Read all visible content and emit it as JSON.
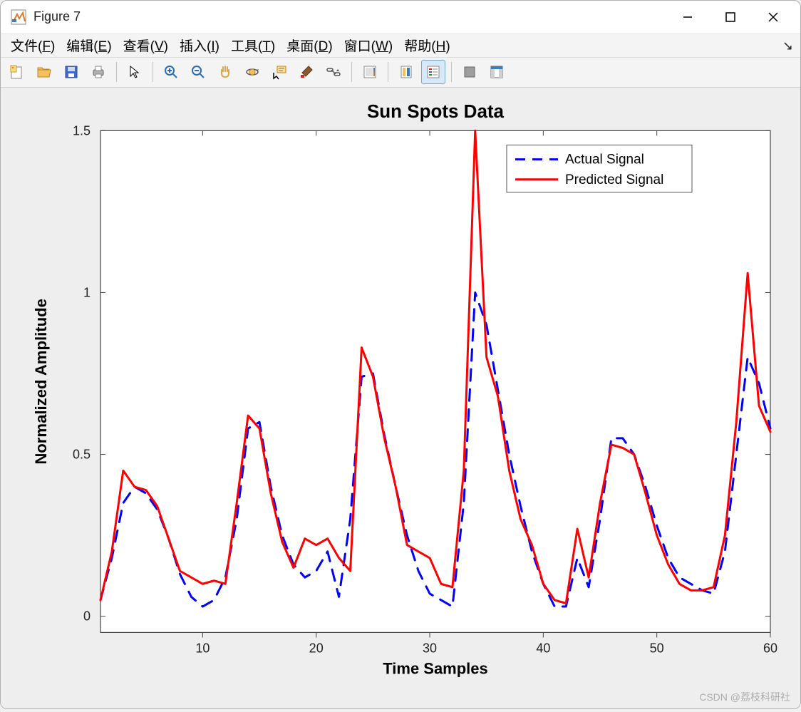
{
  "window": {
    "title": "Figure 7"
  },
  "menu": {
    "items": [
      {
        "label": "文件",
        "hotkey": "F"
      },
      {
        "label": "编辑",
        "hotkey": "E"
      },
      {
        "label": "查看",
        "hotkey": "V"
      },
      {
        "label": "插入",
        "hotkey": "I"
      },
      {
        "label": "工具",
        "hotkey": "T"
      },
      {
        "label": "桌面",
        "hotkey": "D"
      },
      {
        "label": "窗口",
        "hotkey": "W"
      },
      {
        "label": "帮助",
        "hotkey": "H"
      }
    ]
  },
  "toolbar": {
    "icons": [
      "new-figure",
      "open",
      "save",
      "print",
      "|",
      "pointer",
      "|",
      "zoom-in",
      "zoom-out",
      "pan",
      "rotate3d",
      "data-cursor",
      "brush",
      "link",
      "|",
      "colorbar",
      "|",
      "legend",
      "insert-legend",
      "|",
      "hide",
      "dock"
    ]
  },
  "watermark": "CSDN @荔枝科研社",
  "chart_data": {
    "type": "line",
    "title": "Sun Spots Data",
    "xlabel": "Time Samples",
    "ylabel": "Normalized Amplitude",
    "x_ticks": [
      10,
      20,
      30,
      40,
      50,
      60
    ],
    "y_ticks": [
      0,
      0.5,
      1,
      1.5
    ],
    "xlim": [
      1,
      60
    ],
    "ylim": [
      -0.05,
      1.5
    ],
    "legend": {
      "position": "upper-right",
      "entries": [
        "Actual Signal",
        "Predicted Signal"
      ]
    },
    "series": [
      {
        "name": "Actual Signal",
        "color": "#0000ff",
        "style": "dashed",
        "width": 3,
        "x": [
          1,
          2,
          3,
          4,
          5,
          6,
          7,
          8,
          9,
          10,
          11,
          12,
          13,
          14,
          15,
          16,
          17,
          18,
          19,
          20,
          21,
          22,
          23,
          24,
          25,
          26,
          27,
          28,
          29,
          30,
          31,
          32,
          33,
          34,
          35,
          36,
          37,
          38,
          39,
          40,
          41,
          42,
          43,
          44,
          45,
          46,
          47,
          48,
          49,
          50,
          51,
          52,
          53,
          54,
          55,
          56,
          57,
          58,
          59,
          60
        ],
        "y": [
          0.05,
          0.18,
          0.35,
          0.4,
          0.38,
          0.33,
          0.24,
          0.13,
          0.06,
          0.03,
          0.05,
          0.12,
          0.3,
          0.58,
          0.6,
          0.4,
          0.25,
          0.16,
          0.12,
          0.14,
          0.2,
          0.06,
          0.3,
          0.74,
          0.75,
          0.56,
          0.4,
          0.25,
          0.14,
          0.07,
          0.05,
          0.03,
          0.35,
          1.0,
          0.9,
          0.7,
          0.5,
          0.34,
          0.2,
          0.1,
          0.03,
          0.03,
          0.18,
          0.09,
          0.3,
          0.55,
          0.55,
          0.5,
          0.4,
          0.28,
          0.18,
          0.12,
          0.1,
          0.08,
          0.07,
          0.2,
          0.5,
          0.8,
          0.72,
          0.58
        ]
      },
      {
        "name": "Predicted Signal",
        "color": "#ff0000",
        "style": "solid",
        "width": 3,
        "x": [
          1,
          2,
          3,
          4,
          5,
          6,
          7,
          8,
          9,
          10,
          11,
          12,
          13,
          14,
          15,
          16,
          17,
          18,
          19,
          20,
          21,
          22,
          23,
          24,
          25,
          26,
          27,
          28,
          29,
          30,
          31,
          32,
          33,
          34,
          35,
          36,
          37,
          38,
          39,
          40,
          41,
          42,
          43,
          44,
          45,
          46,
          47,
          48,
          49,
          50,
          51,
          52,
          53,
          54,
          55,
          56,
          57,
          58,
          59,
          60
        ],
        "y": [
          0.05,
          0.2,
          0.45,
          0.4,
          0.39,
          0.34,
          0.24,
          0.14,
          0.12,
          0.1,
          0.11,
          0.1,
          0.35,
          0.62,
          0.58,
          0.38,
          0.23,
          0.15,
          0.24,
          0.22,
          0.24,
          0.18,
          0.14,
          0.83,
          0.74,
          0.55,
          0.4,
          0.22,
          0.2,
          0.18,
          0.1,
          0.09,
          0.45,
          1.5,
          0.8,
          0.68,
          0.45,
          0.3,
          0.22,
          0.1,
          0.05,
          0.04,
          0.27,
          0.12,
          0.35,
          0.53,
          0.52,
          0.5,
          0.38,
          0.25,
          0.16,
          0.1,
          0.08,
          0.08,
          0.09,
          0.25,
          0.6,
          1.06,
          0.65,
          0.57
        ]
      }
    ]
  }
}
